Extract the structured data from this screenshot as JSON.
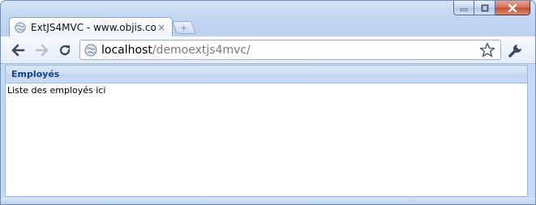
{
  "browser": {
    "tab": {
      "title": "ExtJS4MVC - www.objis.com",
      "close_glyph": "×",
      "favicon_icon": "globe-icon"
    },
    "new_tab_glyph": "+",
    "toolbar": {
      "back_icon": "back-arrow-icon",
      "forward_icon": "forward-arrow-icon",
      "reload_icon": "reload-icon",
      "bookmark_icon": "star-icon",
      "menu_icon": "wrench-icon"
    },
    "omnibox": {
      "host": "localhost",
      "path": "/demoextjs4mvc/"
    },
    "window_controls": [
      "minimize-icon",
      "maximize-icon",
      "close-icon"
    ]
  },
  "page": {
    "panel_title": "Employés",
    "panel_body_text": "Liste des employés ici"
  },
  "colors": {
    "panel_title": "#15428b",
    "panel_border": "#99bbe8",
    "window_frame": "#bcd2ee"
  }
}
